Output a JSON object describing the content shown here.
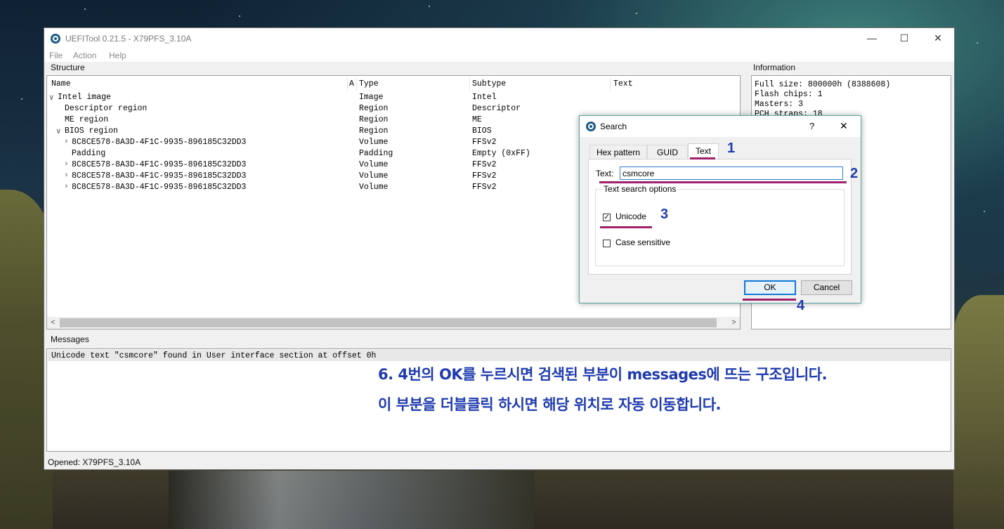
{
  "window": {
    "title": "UEFITool 0.21.5 - X79PFS_3.10A",
    "minimize": "—",
    "maximize": "☐",
    "close": "✕"
  },
  "menu": [
    "File",
    "Action",
    "Help"
  ],
  "structure": {
    "label": "Structure",
    "columns": [
      "Name",
      "A",
      "Type",
      "Subtype",
      "Text"
    ],
    "rows": [
      {
        "chevron": "∨",
        "name": "Intel image",
        "type": "Image",
        "subtype": "Intel"
      },
      {
        "chevron": "",
        "name": "Descriptor region",
        "type": "Region",
        "subtype": "Descriptor"
      },
      {
        "chevron": "",
        "name": "ME region",
        "type": "Region",
        "subtype": "ME"
      },
      {
        "chevron": "∨",
        "name": "BIOS region",
        "type": "Region",
        "subtype": "BIOS"
      },
      {
        "chevron": "›",
        "name": "8C8CE578-8A3D-4F1C-9935-896185C32DD3",
        "type": "Volume",
        "subtype": "FFSv2"
      },
      {
        "chevron": "",
        "name": "Padding",
        "type": "Padding",
        "subtype": "Empty (0xFF)"
      },
      {
        "chevron": "›",
        "name": "8C8CE578-8A3D-4F1C-9935-896185C32DD3",
        "type": "Volume",
        "subtype": "FFSv2"
      },
      {
        "chevron": "›",
        "name": "8C8CE578-8A3D-4F1C-9935-896185C32DD3",
        "type": "Volume",
        "subtype": "FFSv2"
      },
      {
        "chevron": "›",
        "name": "8C8CE578-8A3D-4F1C-9935-896185C32DD3",
        "type": "Volume",
        "subtype": "FFSv2"
      }
    ],
    "scroll_left": "<",
    "scroll_right": ">"
  },
  "information": {
    "label": "Information",
    "lines": [
      "Full size: 800000h (8388608)",
      "Flash chips: 1",
      "Masters: 3",
      "PCH straps: 18"
    ]
  },
  "messages": {
    "label": "Messages",
    "lines": [
      "Unicode text \"csmcore\" found in User interface section at offset 0h"
    ]
  },
  "status": "Opened: X79PFS_3.10A",
  "dialog": {
    "title": "Search",
    "help": "?",
    "close": "✕",
    "tabs": [
      "Hex pattern",
      "GUID",
      "Text"
    ],
    "active_tab": "Text",
    "text_label": "Text:",
    "text_value": "csmcore",
    "options_label": "Text search options",
    "unicode_label": "Unicode",
    "unicode_checked": true,
    "case_label": "Case sensitive",
    "case_checked": false,
    "ok": "OK",
    "cancel": "Cancel"
  },
  "annotations": {
    "n1": "1",
    "n2": "2",
    "n3": "3",
    "n4": "4",
    "line1": "6. 4번의 OK를 누르시면 검색된 부분이 messages에 뜨는 구조입니다.",
    "line2": "이 부분을 더블클릭 하시면 해당 위치로 자동 이동합니다.",
    "color": "#1f3bb0",
    "underline_color": "#a0206a"
  }
}
